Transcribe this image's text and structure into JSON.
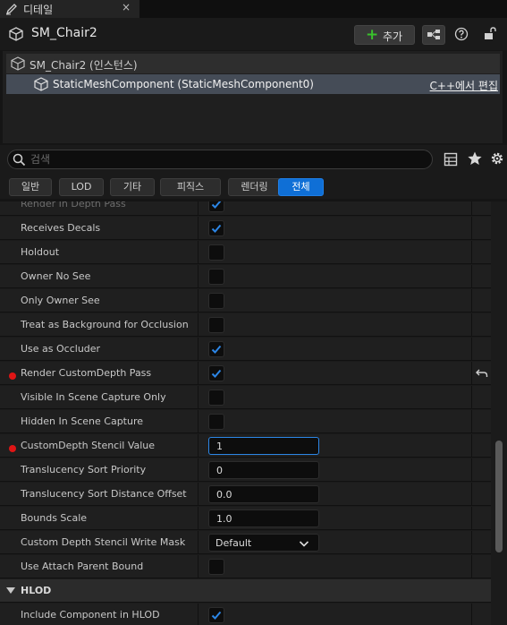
{
  "tab": {
    "title": "디테일",
    "close": "×"
  },
  "header": {
    "title": "SM_Chair2",
    "add_label": "추가"
  },
  "tree": {
    "actor": "SM_Chair2 (인스턴스)",
    "component": "StaticMeshComponent (StaticMeshComponent0)",
    "edit_cpp": "C++에서 편집"
  },
  "search": {
    "placeholder": "검색"
  },
  "filters": [
    "일반",
    "LOD",
    "기타",
    "피직스",
    "렌더링",
    "전체"
  ],
  "active_filter": "전체",
  "accent_color": "#0f6fd6",
  "properties": [
    {
      "name": "Render In Depth Pass",
      "type": "checkbox",
      "checked": true,
      "partial": true
    },
    {
      "name": "Receives Decals",
      "type": "checkbox",
      "checked": true
    },
    {
      "name": "Holdout",
      "type": "checkbox",
      "checked": false
    },
    {
      "name": "Owner No See",
      "type": "checkbox",
      "checked": false
    },
    {
      "name": "Only Owner See",
      "type": "checkbox",
      "checked": false
    },
    {
      "name": "Treat as Background for Occlusion",
      "type": "checkbox",
      "checked": false
    },
    {
      "name": "Use as Occluder",
      "type": "checkbox",
      "checked": true
    },
    {
      "name": "Render CustomDepth Pass",
      "type": "checkbox",
      "checked": true,
      "modified": true
    },
    {
      "name": "Visible In Scene Capture Only",
      "type": "checkbox",
      "checked": false
    },
    {
      "name": "Hidden In Scene Capture",
      "type": "checkbox",
      "checked": false
    },
    {
      "name": "CustomDepth Stencil Value",
      "type": "number",
      "value": "1",
      "modified": true,
      "focused": true
    },
    {
      "name": "Translucency Sort Priority",
      "type": "number",
      "value": "0"
    },
    {
      "name": "Translucency Sort Distance Offset",
      "type": "number",
      "value": "0.0"
    },
    {
      "name": "Bounds Scale",
      "type": "number",
      "value": "1.0"
    },
    {
      "name": "Custom Depth Stencil Write Mask",
      "type": "dropdown",
      "value": "Default"
    },
    {
      "name": "Use Attach Parent Bound",
      "type": "checkbox",
      "checked": false
    },
    {
      "name": "HLOD",
      "type": "section"
    },
    {
      "name": "Include Component in HLOD",
      "type": "checkbox",
      "checked": true
    }
  ]
}
